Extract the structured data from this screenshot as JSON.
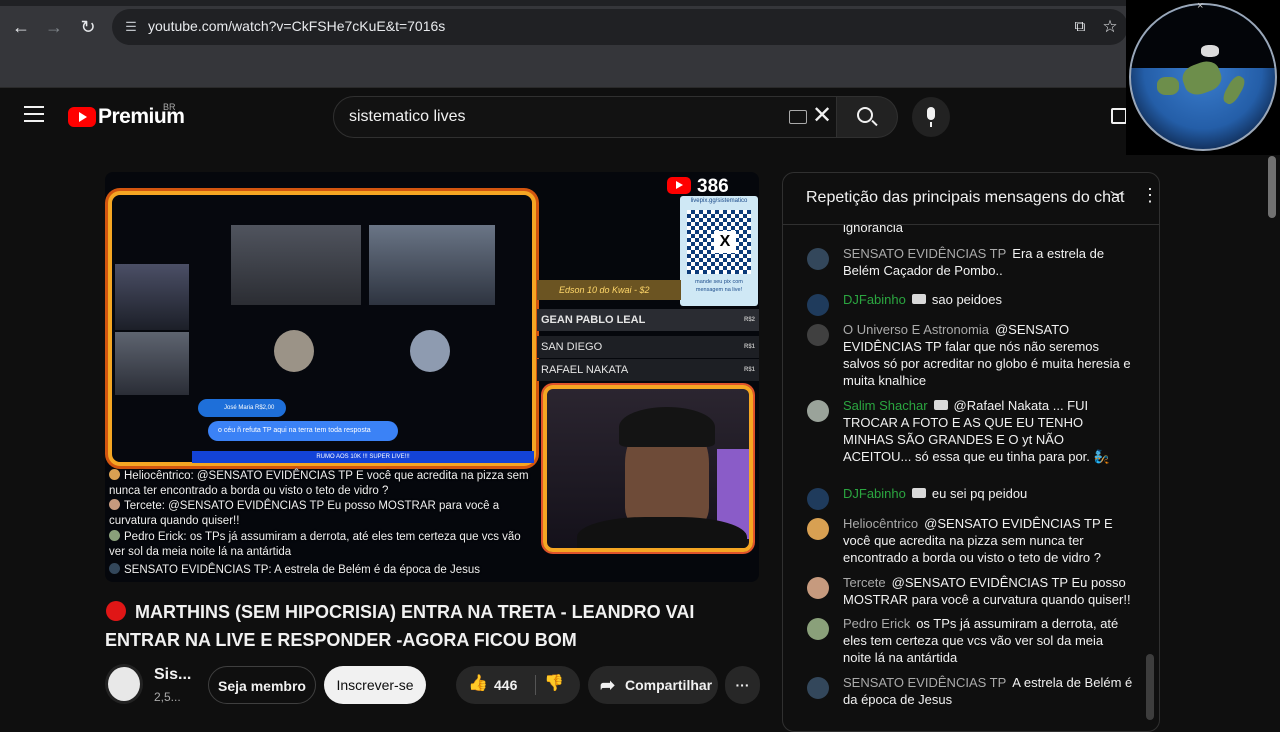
{
  "browser": {
    "url": "youtube.com/watch?v=CkFSHe7cKuE&t=7016s"
  },
  "header": {
    "logo_text": "Premium",
    "country": "BR",
    "search_value": "sistematico lives"
  },
  "video": {
    "live_viewers": "386",
    "qr_top_label": "livepix.gg/sistematico",
    "qr_center": "X",
    "qr_bottom_label": "mande seu pix com mensagem na live!",
    "donor_highlight": "Edson 10 do Kwai - $2",
    "donors": [
      {
        "name": "GEAN PABLO LEAL",
        "amount": "R$2"
      },
      {
        "name": "SAN DIEGO",
        "amount": "R$1"
      },
      {
        "name": "RAFAEL NAKATA",
        "amount": "R$1"
      }
    ],
    "overlay_comment_name": "José Maria  R$2,00",
    "overlay_comment_text": "o céu ñ refuta TP aqui na terra tem toda resposta",
    "rumo_bar": "RUMO AOS 10K !!! SUPER LIVE!!!",
    "overlay_comments": [
      {
        "text": "Heliocêntrico: @SENSATO EVIDÊNCIAS TP E você que acredita na pizza sem nunca ter encontrado a borda ou visto o teto de vidro ?"
      },
      {
        "text": "Tercete: @SENSATO EVIDÊNCIAS TP Eu posso MOSTRAR para você a curvatura quando quiser!!"
      },
      {
        "text": "Pedro Erick: os TPs já assumiram a derrota, até eles tem certeza que vcs vão ver sol da meia noite lá na antártida"
      },
      {
        "text": "SENSATO EVIDÊNCIAS TP: A estrela de Belém é da época de Jesus"
      }
    ],
    "title": "MARTHINS (SEM HIPOCRISIA) ENTRA NA TRETA - LEANDRO VAI ENTRAR NA LIVE E RESPONDER -AGORA FICOU BOM",
    "channel_name": "Sis...",
    "subscribers": "2,5...",
    "member_label": "Seja membro",
    "subscribe_label": "Inscrever-se",
    "likes": "446",
    "share_label": "Compartilhar",
    "more_label": "···"
  },
  "chat": {
    "title": "Repetição das principais mensagens do chat",
    "messages": [
      {
        "author": "",
        "text": "ignorância",
        "member": false,
        "avatar_color": "#2b2b2b"
      },
      {
        "author": "SENSATO EVIDÊNCIAS TP",
        "text": "Era a estrela de Belém Caçador de Pombo..",
        "member": false,
        "avatar_color": "#33475b"
      },
      {
        "author": "DJFabinho",
        "text": "sao peidoes",
        "member": true,
        "avatar_color": "#1f3b5c"
      },
      {
        "author": "O Universo E Astronomia",
        "text": "@SENSATO EVIDÊNCIAS TP falar que nós não seremos salvos só por acreditar no globo é muita heresia e muita knalhice",
        "member": false,
        "avatar_color": "#404040"
      },
      {
        "author": "Salim Shachar",
        "text": "@Rafael Nakata ... FUI TROCAR A FOTO E AS QUE EU TENHO MINHAS SÃO GRANDES E O yt NÃO ACEITOU... só essa que eu tinha para por. 🧞",
        "member": true,
        "avatar_color": "#9aa39a"
      },
      {
        "author": "DJFabinho",
        "text": "eu sei pq peidou",
        "member": true,
        "avatar_color": "#1f3b5c"
      },
      {
        "author": "Heliocêntrico",
        "text": "@SENSATO EVIDÊNCIAS TP E você que acredita na pizza sem nunca ter encontrado a borda ou visto o teto de vidro ?",
        "member": false,
        "avatar_color": "#d8a052"
      },
      {
        "author": "Tercete",
        "text": "@SENSATO EVIDÊNCIAS TP Eu posso MOSTRAR para você a curvatura quando quiser!!",
        "member": false,
        "avatar_color": "#c69a7e"
      },
      {
        "author": "Pedro Erick",
        "text": "os TPs já assumiram a derrota, até eles tem certeza que vcs vão ver sol da meia noite lá na antártida",
        "member": false,
        "avatar_color": "#8aa07a"
      },
      {
        "author": "SENSATO EVIDÊNCIAS TP",
        "text": "A estrela de Belém é da época de Jesus",
        "member": false,
        "avatar_color": "#33475b"
      }
    ]
  }
}
